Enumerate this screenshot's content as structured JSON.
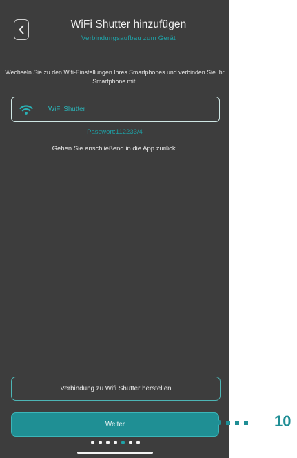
{
  "header": {
    "title": "WiFi Shutter hinzufügen",
    "subtitle": "Verbindungsaufbau zum Gerät"
  },
  "instruction": "Wechseln Sie zu den Wifi-Einstellungen Ihres Smartphones und verbinden Sie Ihr Smartphone mit:",
  "wifi_network": {
    "icon": "wifi-icon",
    "name": "WiFi Shutter"
  },
  "password": {
    "label": "Passwort:",
    "value": "112233/4"
  },
  "return_text": "Gehen Sie anschließend in die App zurück.",
  "buttons": {
    "connect": "Verbindung zu Wifi Shutter herstellen",
    "next": "Weiter"
  },
  "pager": {
    "total": 7,
    "active_index": 4
  },
  "callout": {
    "number": "10"
  },
  "colors": {
    "background": "#3d3d3d",
    "accent": "#1fa3a8",
    "button_fill": "#1f8f94",
    "callout": "#1f8e95"
  }
}
